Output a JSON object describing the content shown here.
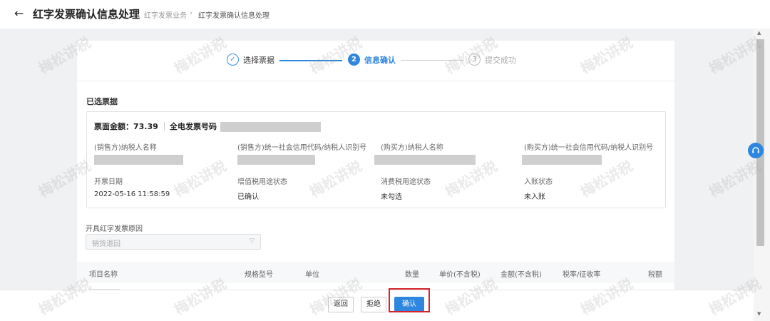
{
  "header": {
    "back_icon": "←",
    "title": "红字发票确认信息处理",
    "breadcrumb": [
      "红字发票业务",
      "红字发票确认信息处理"
    ],
    "breadcrumb_sep": "›"
  },
  "steps": [
    {
      "mark": "✓",
      "label": "选择票据",
      "state": "done"
    },
    {
      "mark": "2",
      "label": "信息确认",
      "state": "active"
    },
    {
      "mark": "3",
      "label": "提交成功",
      "state": "todo"
    }
  ],
  "selected": {
    "section_title": "已选票据",
    "amount": "票面金额：73.39",
    "invoice_no_label": "全电发票号码",
    "fields_row1": [
      "(销售方)纳税人名称",
      "(销售方)统一社会信用代码/纳税人识别号",
      "(购买方)纳税人名称",
      "(购买方)统一社会信用代码/纳税人识别号"
    ],
    "fields_row2_labels": [
      "开票日期",
      "增值税用途状态",
      "消费税用途状态",
      "入账状态"
    ],
    "fields_row2_values": [
      "2022-05-16 11:58:59",
      "已确认",
      "未勾选",
      "未入账"
    ]
  },
  "reason": {
    "label": "开具红字发票原因",
    "value": "销货退回"
  },
  "table": {
    "headers": [
      "项目名称",
      "规格型号",
      "单位",
      "数量",
      "单价(不含税)",
      "金额(不含税)",
      "税率/征收率",
      "税额"
    ]
  },
  "footer": {
    "back_label": "返回",
    "reject_label": "拒绝",
    "confirm_label": "确认"
  },
  "icons": {
    "help": "headset-icon",
    "chevron": "▽"
  },
  "watermark": "梅松讲税",
  "colors": {
    "accent": "#2e86de",
    "highlight": "#d8232a"
  }
}
